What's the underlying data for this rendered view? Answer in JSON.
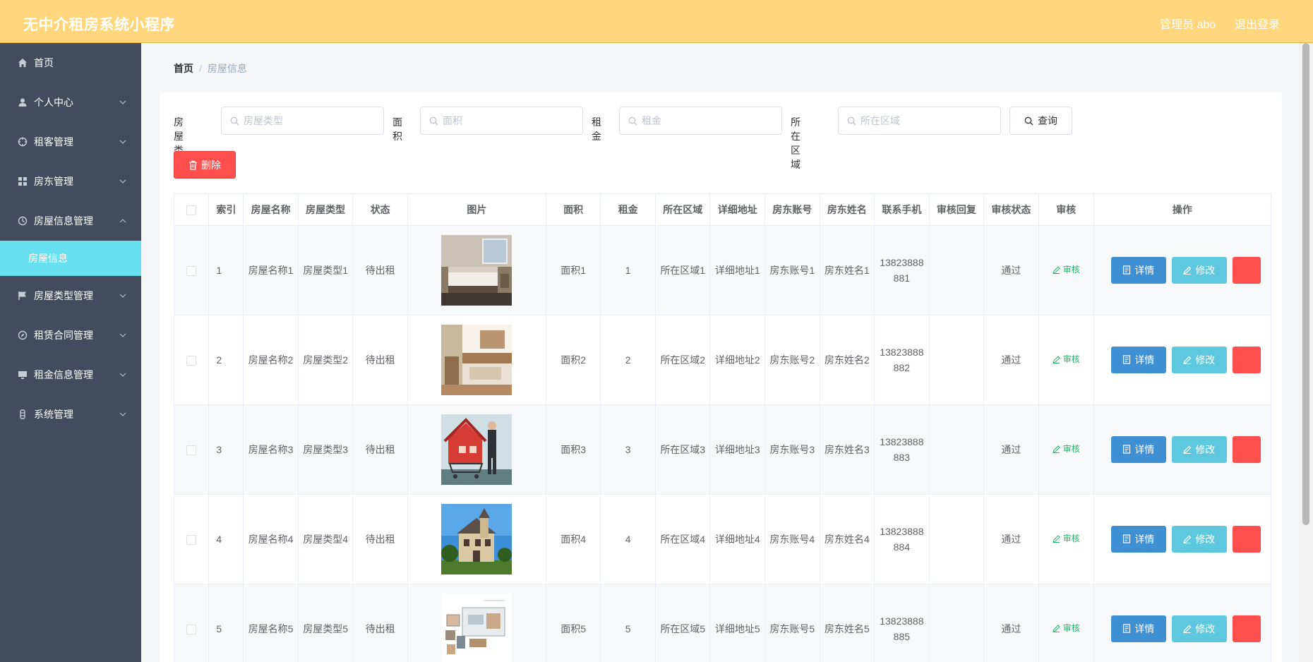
{
  "header": {
    "title": "无中介租房系统小程序",
    "admin_label": "管理员 abo",
    "logout_label": "退出登录"
  },
  "sidebar": {
    "items": [
      {
        "label": "首页",
        "icon": "home-icon",
        "expandable": false
      },
      {
        "label": "个人中心",
        "icon": "user-icon",
        "expandable": true
      },
      {
        "label": "租客管理",
        "icon": "target-icon",
        "expandable": true
      },
      {
        "label": "房东管理",
        "icon": "grid-icon",
        "expandable": true
      },
      {
        "label": "房屋信息管理",
        "icon": "clock-icon",
        "expandable": true,
        "expanded": true
      },
      {
        "label": "房屋类型管理",
        "icon": "flag-icon",
        "expandable": true
      },
      {
        "label": "租赁合同管理",
        "icon": "compass-icon",
        "expandable": true
      },
      {
        "label": "租金信息管理",
        "icon": "monitor-icon",
        "expandable": true
      },
      {
        "label": "系统管理",
        "icon": "bottle-icon",
        "expandable": true
      }
    ],
    "active_sub_item": "房屋信息"
  },
  "breadcrumb": {
    "home": "首页",
    "separator": "/",
    "current": "房屋信息"
  },
  "search": {
    "type_label": "房屋类型",
    "type_placeholder": "房屋类型",
    "area_label": "面积",
    "area_placeholder": "面积",
    "rent_label": "租金",
    "rent_placeholder": "租金",
    "region_label": "所在区域",
    "region_placeholder": "所在区域",
    "query_label": "查询"
  },
  "actions": {
    "delete_label": "删除"
  },
  "table": {
    "headers": [
      "",
      "索引",
      "房屋名称",
      "房屋类型",
      "状态",
      "图片",
      "面积",
      "租金",
      "所在区域",
      "详细地址",
      "房东账号",
      "房东姓名",
      "联系手机",
      "审核回复",
      "审核状态",
      "审核",
      "操作"
    ],
    "rows": [
      {
        "index": "1",
        "name": "房屋名称1",
        "type": "房屋类型1",
        "status": "待出租",
        "image": "bedroom-photo",
        "area": "面积1",
        "rent": "1",
        "region": "所在区域1",
        "address": "详细地址1",
        "account": "房东账号1",
        "owner": "房东姓名1",
        "phone": "13823888881",
        "reply": "",
        "audit_status": "通过",
        "audit_label": "审核",
        "detail_label": "详情",
        "edit_label": "修改"
      },
      {
        "index": "2",
        "name": "房屋名称2",
        "type": "房屋类型2",
        "status": "待出租",
        "image": "loft-interior-photo",
        "area": "面积2",
        "rent": "2",
        "region": "所在区域2",
        "address": "详细地址2",
        "account": "房东账号2",
        "owner": "房东姓名2",
        "phone": "13823888882",
        "reply": "",
        "audit_status": "通过",
        "audit_label": "审核",
        "detail_label": "详情",
        "edit_label": "修改"
      },
      {
        "index": "3",
        "name": "房屋名称3",
        "type": "房屋类型3",
        "status": "待出租",
        "image": "house-in-cart-photo",
        "area": "面积3",
        "rent": "3",
        "region": "所在区域3",
        "address": "详细地址3",
        "account": "房东账号3",
        "owner": "房东姓名3",
        "phone": "13823888883",
        "reply": "",
        "audit_status": "通过",
        "audit_label": "审核",
        "detail_label": "详情",
        "edit_label": "修改"
      },
      {
        "index": "4",
        "name": "房屋名称4",
        "type": "房屋类型4",
        "status": "待出租",
        "image": "victorian-house-photo",
        "area": "面积4",
        "rent": "4",
        "region": "所在区域4",
        "address": "详细地址4",
        "account": "房东账号4",
        "owner": "房东姓名4",
        "phone": "13823888884",
        "reply": "",
        "audit_status": "通过",
        "audit_label": "审核",
        "detail_label": "详情",
        "edit_label": "修改"
      },
      {
        "index": "5",
        "name": "房屋名称5",
        "type": "房屋类型5",
        "status": "待出租",
        "image": "floorplan-sketch-photo",
        "area": "面积5",
        "rent": "5",
        "region": "所在区域5",
        "address": "详细地址5",
        "account": "房东账号5",
        "owner": "房东姓名5",
        "phone": "13823888885",
        "reply": "",
        "audit_status": "通过",
        "audit_label": "审核",
        "detail_label": "详情",
        "edit_label": "修改"
      }
    ]
  },
  "colors": {
    "header_bg": "#ffd67c",
    "sidebar_bg": "#434b5c",
    "sidebar_active": "#67e0f0",
    "danger": "#ff4e4e",
    "primary": "#3f8fd3",
    "info": "#5ec8de",
    "success": "#26b26b"
  }
}
